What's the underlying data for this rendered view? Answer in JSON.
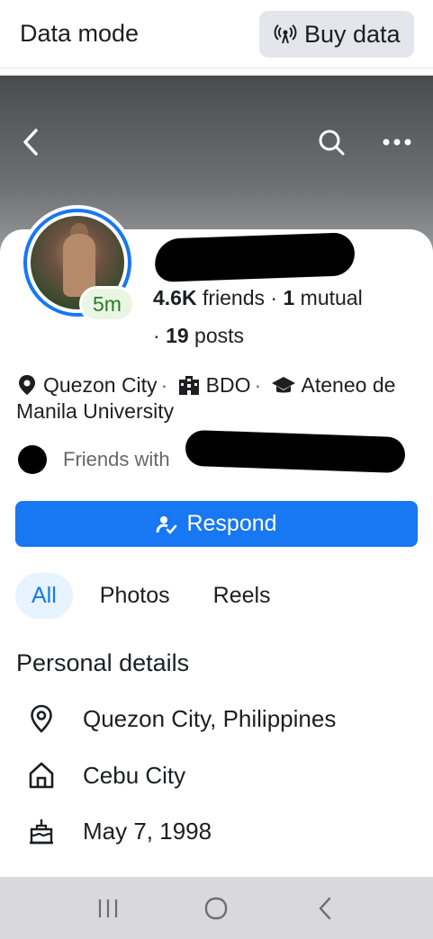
{
  "datamode": {
    "title": "Data mode",
    "buy_label": "Buy data"
  },
  "profile": {
    "active_badge": "5m",
    "friends_count": "4.6K",
    "friends_label": " friends · ",
    "mutual_count": "1",
    "mutual_label": " mutual",
    "posts_prefix": "· ",
    "posts_count": "19",
    "posts_label": " posts",
    "location": "Quezon City",
    "work": "BDO",
    "education": "Ateneo de Manila University",
    "mutual_text": "Friends with "
  },
  "actions": {
    "respond_label": "Respond"
  },
  "tabs": [
    {
      "label": "All",
      "active": true
    },
    {
      "label": "Photos",
      "active": false
    },
    {
      "label": "Reels",
      "active": false
    }
  ],
  "personal_details": {
    "title": "Personal details",
    "items": [
      {
        "icon": "location-pin-icon",
        "text": "Quezon City, Philippines"
      },
      {
        "icon": "home-icon",
        "text": "Cebu City"
      },
      {
        "icon": "birthday-cake-icon",
        "text": "May 7, 1998"
      }
    ]
  },
  "colors": {
    "accent": "#1877f2",
    "active_badge_bg": "#e9f6e4",
    "active_badge_text": "#2c7a2a"
  }
}
